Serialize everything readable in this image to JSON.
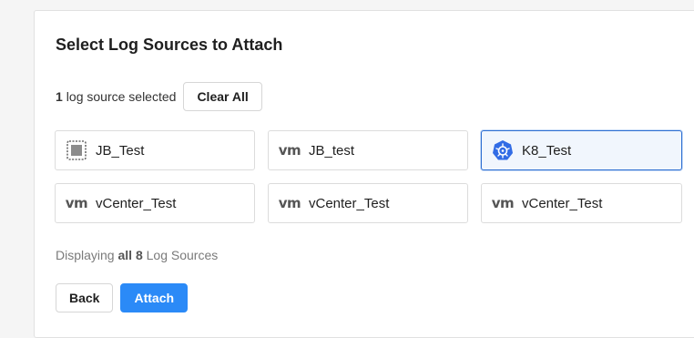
{
  "dialog": {
    "title": "Select Log Sources to Attach",
    "selection": {
      "count": "1",
      "suffix": "log source selected",
      "clear_label": "Clear All"
    },
    "sources": [
      {
        "label": "JB_Test",
        "icon": "chip-icon",
        "selected": false
      },
      {
        "label": "JB_test",
        "icon": "vmware-logo-icon",
        "selected": false
      },
      {
        "label": "K8_Test",
        "icon": "kubernetes-icon",
        "selected": true
      },
      {
        "label": "vCenter_Test",
        "icon": "vmware-logo-icon",
        "selected": false
      },
      {
        "label": "vCenter_Test",
        "icon": "vmware-logo-icon",
        "selected": false
      },
      {
        "label": "vCenter_Test",
        "icon": "vmware-logo-icon",
        "selected": false
      }
    ],
    "footer": {
      "prefix": "Displaying",
      "emphasis": "all 8",
      "suffix": "Log Sources"
    },
    "buttons": {
      "back_label": "Back",
      "attach_label": "Attach"
    },
    "vm_logo_text": "vm"
  },
  "colors": {
    "accent": "#2b8af7",
    "selected_border": "#2f6fd1",
    "selected_bg": "#f1f6fd",
    "kubernetes": "#326ce5"
  }
}
